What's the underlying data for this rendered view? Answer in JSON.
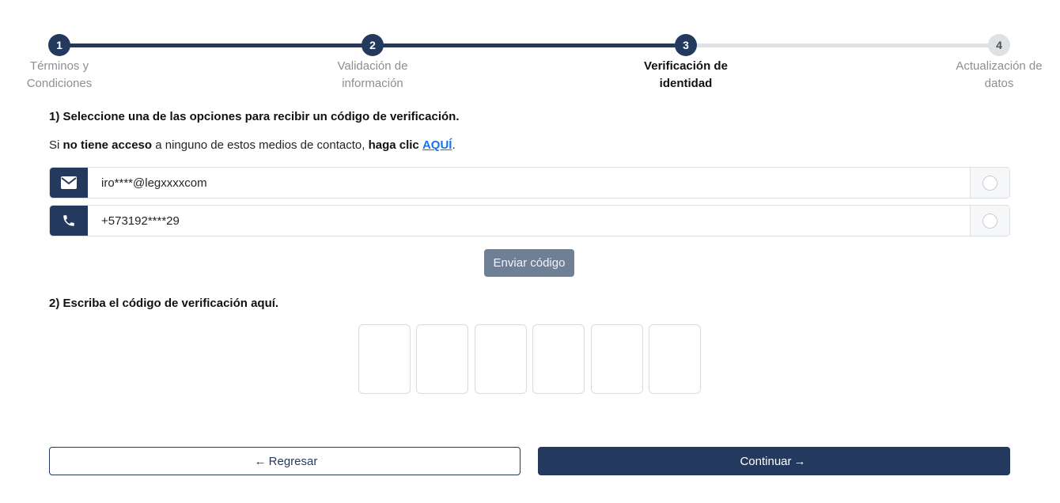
{
  "stepper": {
    "steps": [
      {
        "number": "1",
        "label": "Términos y Condiciones",
        "state": "done"
      },
      {
        "number": "2",
        "label": "Validación de información",
        "state": "done"
      },
      {
        "number": "3",
        "label": "Verificación de identidad",
        "state": "current"
      },
      {
        "number": "4",
        "label": "Actualización de datos",
        "state": "todo"
      }
    ]
  },
  "section1": {
    "heading": "1) Seleccione una de las opciones para recibir un código de verificación.",
    "note": {
      "prefix": "Si ",
      "bold1": "no tiene acceso",
      "middle": " a ninguno de estos medios de contacto, ",
      "bold2": "haga clic",
      "link": "AQUÍ",
      "suffix": "."
    },
    "options": [
      {
        "icon": "envelope-icon",
        "value": "iro****@legxxxxcom"
      },
      {
        "icon": "phone-icon",
        "value": "+573192****29"
      }
    ],
    "send_label": "Enviar código"
  },
  "section2": {
    "heading": "2) Escriba el código de verificación aquí."
  },
  "footer": {
    "back_arrow": "←",
    "back_label": "Regresar",
    "next_label": "Continuar",
    "next_arrow": "→"
  },
  "colors": {
    "primary": "#233a5e",
    "inactive": "#dfe1e4",
    "link": "#1a73e8",
    "send_button": "#6e7f96"
  }
}
